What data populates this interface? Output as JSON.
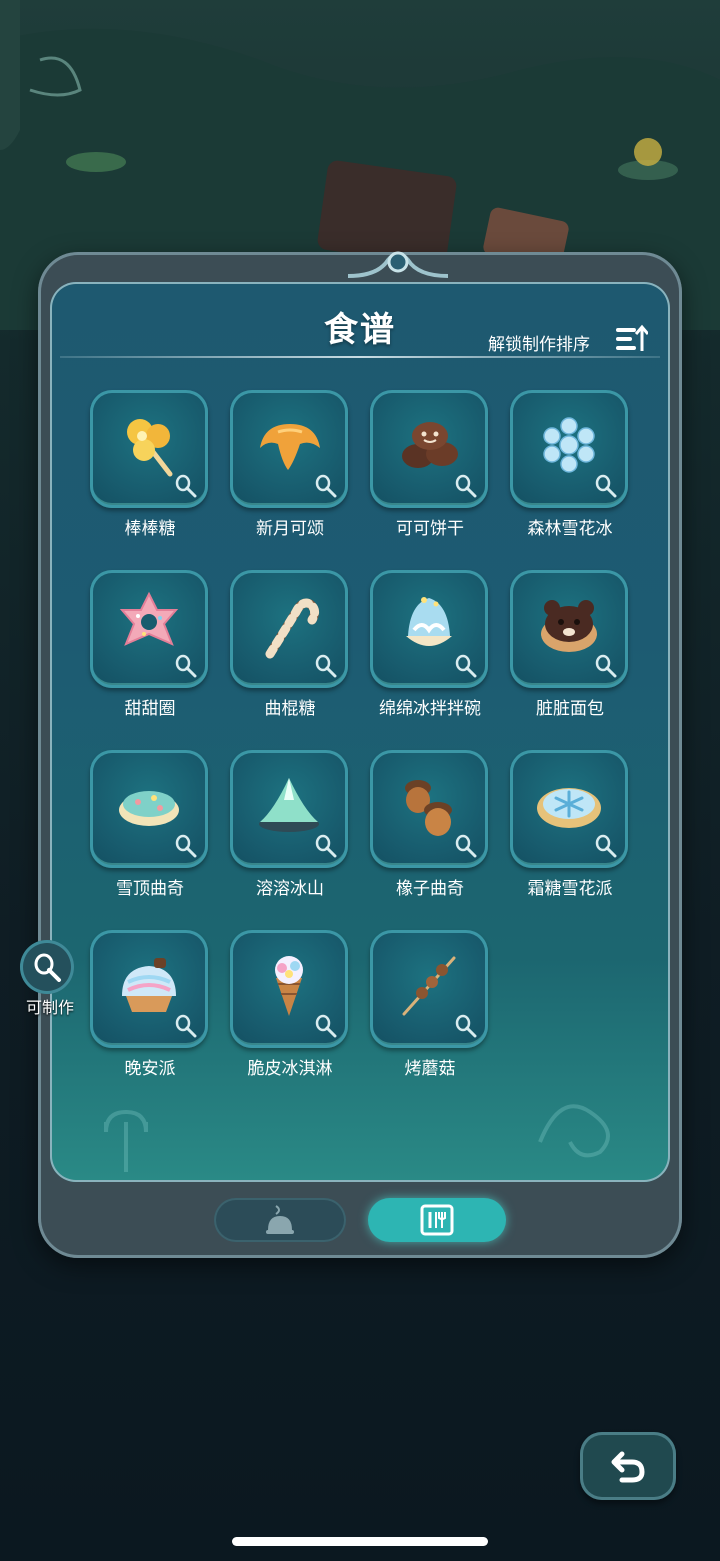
{
  "panel": {
    "title": "食谱",
    "sort_label": "解锁制作排序",
    "sort_icon": "sort-list-icon"
  },
  "recipes": [
    {
      "name": "棒棒糖",
      "icon": "lollipop-icon"
    },
    {
      "name": "新月可颂",
      "icon": "croissant-icon"
    },
    {
      "name": "可可饼干",
      "icon": "cocoa-cookie-icon"
    },
    {
      "name": "森林雪花冰",
      "icon": "snowflake-ice-icon"
    },
    {
      "name": "甜甜圈",
      "icon": "donut-icon"
    },
    {
      "name": "曲棍糖",
      "icon": "candy-cane-icon"
    },
    {
      "name": "绵绵冰拌拌碗",
      "icon": "shaved-ice-bowl-icon"
    },
    {
      "name": "脏脏面包",
      "icon": "bear-bread-icon"
    },
    {
      "name": "雪顶曲奇",
      "icon": "snowtop-cookie-icon"
    },
    {
      "name": "溶溶冰山",
      "icon": "jelly-mountain-icon"
    },
    {
      "name": "橡子曲奇",
      "icon": "acorn-cookie-icon"
    },
    {
      "name": "霜糖雪花派",
      "icon": "snowflake-pie-icon"
    },
    {
      "name": "晚安派",
      "icon": "goodnight-pie-icon"
    },
    {
      "name": "脆皮冰淇淋",
      "icon": "ice-cream-cone-icon"
    },
    {
      "name": "烤蘑菇",
      "icon": "mushroom-skewer-icon"
    }
  ],
  "tabs": [
    {
      "id": "cooking",
      "icon": "cooking-pot-icon",
      "active": false
    },
    {
      "id": "recipes",
      "icon": "recipe-book-icon",
      "active": true
    }
  ],
  "side": {
    "craftable_label": "可制作",
    "craftable_icon": "whisk-icon"
  },
  "nav": {
    "back_icon": "back-arrow-icon"
  },
  "colors": {
    "accent": "#2db5b3",
    "panel": "#1e5970",
    "tile_border": "#3b97a6"
  }
}
